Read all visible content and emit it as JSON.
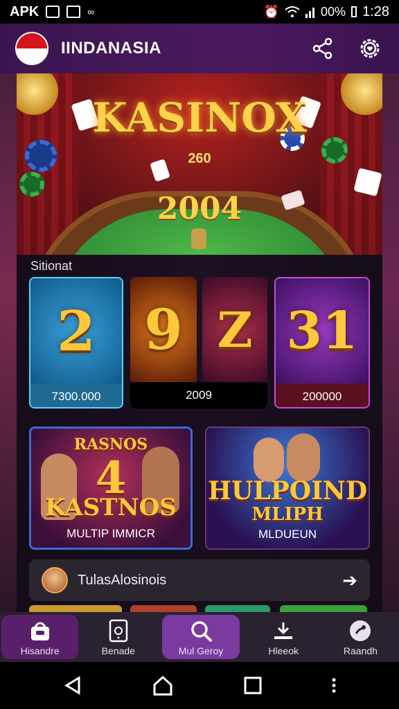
{
  "status_bar": {
    "left_text": "APK",
    "battery": "00%",
    "time": "1:28"
  },
  "header": {
    "brand": "IINDANASIA"
  },
  "hero": {
    "title": "KASINOX",
    "score_top": "260",
    "score_main": "2004"
  },
  "section": {
    "title": "Sitionat"
  },
  "slots": [
    {
      "symbol": "2",
      "value": "7300.000"
    },
    {
      "symbol": "9",
      "value": "2009"
    },
    {
      "symbol": "Z",
      "value": ""
    },
    {
      "symbol": "31",
      "value": "200000"
    }
  ],
  "promos": [
    {
      "top": "RASNOS",
      "big": "4",
      "headline": "KASTNOS",
      "caption": "MULTIP IMMICR"
    },
    {
      "headline": "HULPOIND",
      "headline2": "MLIPH",
      "caption": "MLDUEUN"
    }
  ],
  "tutorial": {
    "label": "TulasAlosinois"
  },
  "bottom_nav": [
    {
      "label": "Hisandre"
    },
    {
      "label": "Benade"
    },
    {
      "label": "Mul Geroy"
    },
    {
      "label": "Hleeok"
    },
    {
      "label": "Raandh"
    }
  ],
  "colors": {
    "accent": "#7a3aa0",
    "header_bg": "#4a1a5e",
    "gold": "#ffc83a"
  }
}
